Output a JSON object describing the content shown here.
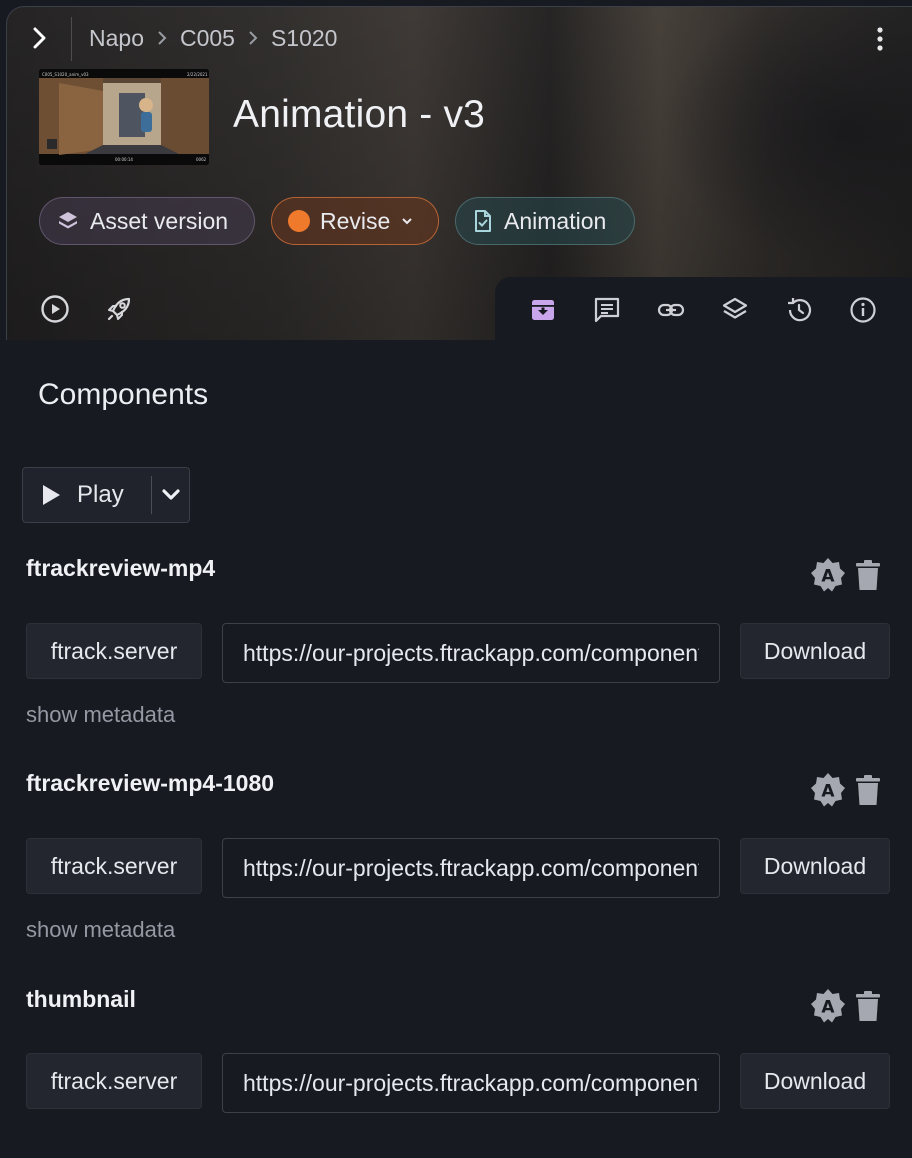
{
  "breadcrumb": [
    "Napo",
    "C005",
    "S1020"
  ],
  "title": "Animation - v3",
  "thumbnail": {
    "top_left": "C005_S1020_anim_v03",
    "top_right": "2/22/2021",
    "bottom_center": "00:00:14",
    "bottom_right": "0062"
  },
  "chips": {
    "asset": "Asset version",
    "status": "Revise",
    "type": "Animation",
    "status_color": "#f07a2c"
  },
  "tabs": [
    {
      "icon": "archive-down-icon",
      "active": true
    },
    {
      "icon": "notes-icon",
      "active": false
    },
    {
      "icon": "link-icon",
      "active": false
    },
    {
      "icon": "layers-icon",
      "active": false
    },
    {
      "icon": "history-icon",
      "active": false
    },
    {
      "icon": "info-icon",
      "active": false
    }
  ],
  "components_title": "Components",
  "play_label": "Play",
  "components": [
    {
      "name": "ftrackreview-mp4",
      "location": "ftrack.server",
      "url": "https://our-projects.ftrackapp.com/component/get?id=…",
      "download_label": "Download",
      "metadata_label": "show metadata"
    },
    {
      "name": "ftrackreview-mp4-1080",
      "location": "ftrack.server",
      "url": "https://our-projects.ftrackapp.com/component/get?id=…",
      "download_label": "Download",
      "metadata_label": "show metadata"
    },
    {
      "name": "thumbnail",
      "location": "ftrack.server",
      "url": "https://our-projects.ftrackapp.com/component/get?id=…",
      "download_label": "Download"
    }
  ],
  "accent_color": "#b18ad8"
}
